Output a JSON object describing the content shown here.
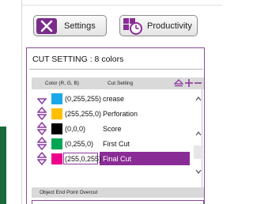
{
  "toolbar": {
    "settings_label": "Settings",
    "productivity_label": "Productivity"
  },
  "cut_setting": {
    "title": "CUT SETTING : 8 colors",
    "header": {
      "color_col": "Color (R, G, B)",
      "setting_col": "Cut Setting"
    },
    "rows": [
      {
        "rgb": "(0,255,255)",
        "name": "crease",
        "color": "#1aa9e8",
        "selected": false
      },
      {
        "rgb": "(255,255,0)",
        "name": "Perforation",
        "color": "#ffbf00",
        "selected": false
      },
      {
        "rgb": "(0,0,0)",
        "name": "Score",
        "color": "#000000",
        "selected": false
      },
      {
        "rgb": "(0,255,0)",
        "name": "First Cut",
        "color": "#00a651",
        "selected": false
      },
      {
        "rgb": "(255,0,255)",
        "name": "Final Cut",
        "color": "#ec008c",
        "selected": true
      }
    ],
    "footer_label": "Object End Point Overcut"
  },
  "colors": {
    "accent": "#8a2c96",
    "border": "#8a4a9a",
    "header_bg": "#d9d9d9"
  }
}
